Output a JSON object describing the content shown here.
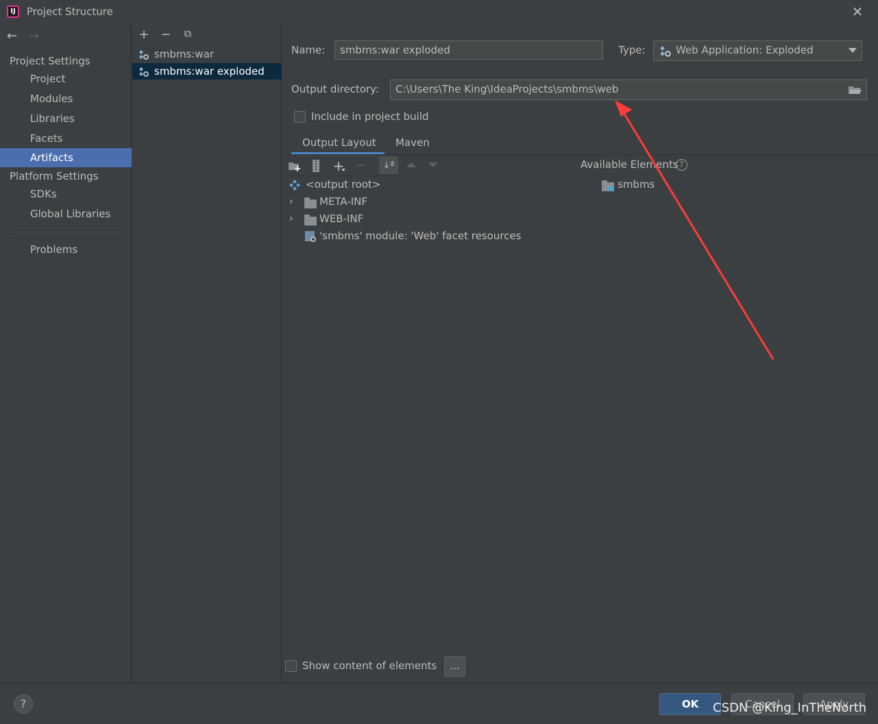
{
  "window": {
    "title": "Project Structure"
  },
  "sidebar": {
    "sections": [
      {
        "header": "Project Settings",
        "items": [
          "Project",
          "Modules",
          "Libraries",
          "Facets",
          "Artifacts"
        ]
      },
      {
        "header": "Platform Settings",
        "items": [
          "SDKs",
          "Global Libraries"
        ]
      }
    ],
    "problems": "Problems",
    "selected": "Artifacts"
  },
  "artifacts": {
    "items": [
      "smbms:war",
      "smbms:war exploded"
    ],
    "selected": "smbms:war exploded"
  },
  "form": {
    "name_label": "Name:",
    "name_value": "smbms:war exploded",
    "type_label": "Type:",
    "type_value": "Web Application: Exploded",
    "output_label": "Output directory:",
    "output_value": "C:\\Users\\The King\\IdeaProjects\\smbms\\web",
    "include_build_label": "Include in project build",
    "include_build_checked": false
  },
  "tabs": [
    {
      "label": "Output Layout",
      "active": true
    },
    {
      "label": "Maven",
      "active": false
    }
  ],
  "layout_tree": {
    "root": "<output root>",
    "items": [
      {
        "label": "META-INF",
        "expandable": true
      },
      {
        "label": "WEB-INF",
        "expandable": true
      },
      {
        "label": "'smbms' module: 'Web' facet resources",
        "expandable": false
      }
    ]
  },
  "available": {
    "label": "Available Elements",
    "items": [
      "smbms"
    ]
  },
  "show_content": {
    "label": "Show content of elements",
    "checked": false,
    "button": "..."
  },
  "footer": {
    "help": "?",
    "ok": "OK",
    "cancel": "Cancel",
    "apply": "Apply"
  },
  "watermark": "CSDN @King_InTheNorth",
  "colors": {
    "background": "#3c3f41",
    "selection": "#4b6eaf",
    "annotation_arrow": "#ff3b3b",
    "accent_tab": "#4a88c7"
  }
}
